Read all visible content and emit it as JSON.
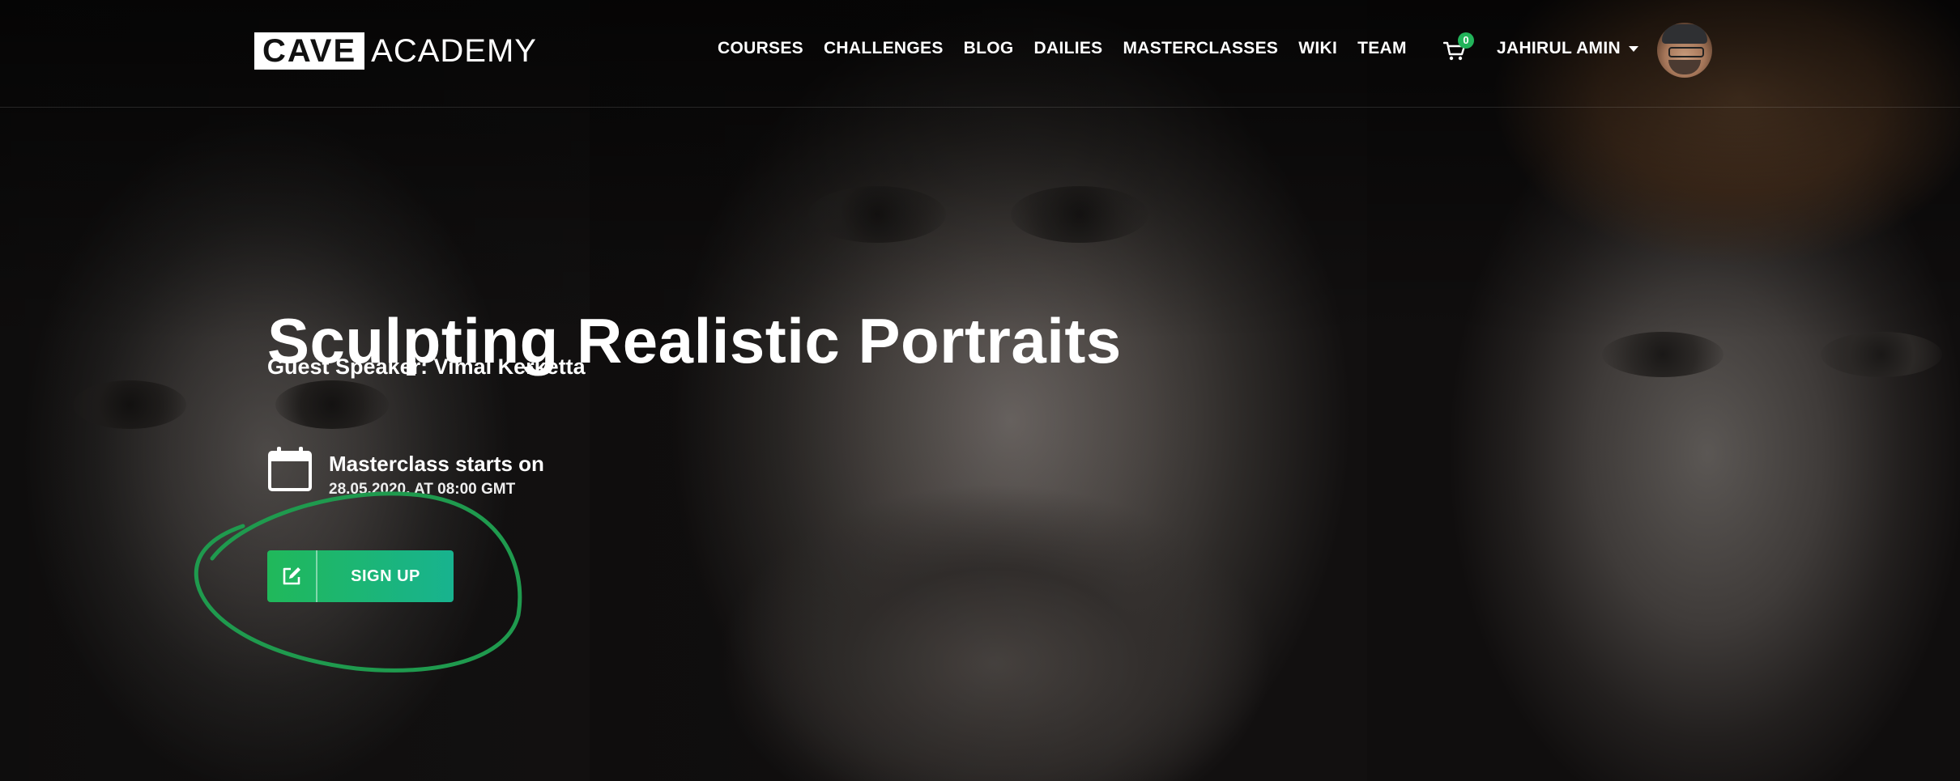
{
  "brand": {
    "logo_box": "CAVE",
    "logo_text": "ACADEMY"
  },
  "nav": {
    "items": [
      {
        "label": "COURSES"
      },
      {
        "label": "CHALLENGES"
      },
      {
        "label": "BLOG"
      },
      {
        "label": "DAILIES"
      },
      {
        "label": "MASTERCLASSES"
      },
      {
        "label": "WIKI"
      },
      {
        "label": "TEAM"
      }
    ]
  },
  "cart": {
    "icon": "cart-icon",
    "count": "0",
    "badge_color": "#22b35a"
  },
  "user": {
    "name": "JAHIRUL AMIN",
    "icon": "chevron-down-icon",
    "avatar": "avatar"
  },
  "hero": {
    "title": "Sculpting Realistic Portraits",
    "subtitle": "Guest Speaker: Vimal Kerketta",
    "start_label": "Masterclass starts on",
    "start_date": "28.05.2020, AT 08:00 GMT",
    "calendar_icon": "calendar-icon",
    "signup": {
      "label": "SIGN UP",
      "icon": "edit-icon"
    }
  },
  "colors": {
    "accent_green": "#20b85a",
    "accent_teal": "#18b38f",
    "annotation": "#1f9a4e"
  }
}
